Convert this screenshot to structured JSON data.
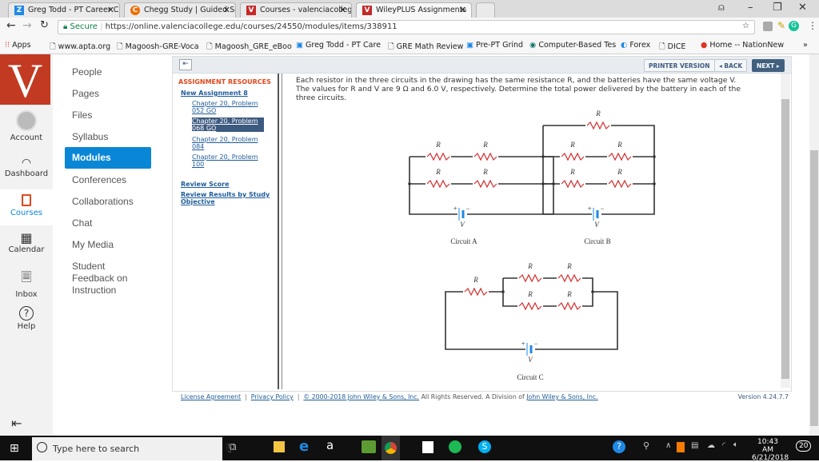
{
  "browser": {
    "tabs": [
      {
        "label": "Greg Todd - PT Career Co",
        "favicon_color": "#1e88e5",
        "icon": "Z"
      },
      {
        "label": "Chegg Study | Guided So",
        "favicon_color": "#ef6c00",
        "icon": "C"
      },
      {
        "label": "Courses - valenciacollege",
        "favicon_color": "#c62828",
        "icon": "V"
      },
      {
        "label": "WileyPLUS Assignments",
        "favicon_color": "#c62828",
        "icon": "V"
      }
    ],
    "secure_label": "Secure",
    "url": "https://online.valenciacollege.edu/courses/24550/modules/items/338911",
    "bookmarks": [
      "Apps",
      "www.apta.org",
      "Magoosh-GRE-Voca",
      "Magoosh_GRE_eBoo",
      "Greg Todd - PT Care",
      "GRE Math Review",
      "Pre-PT Grind",
      "Computer-Based Tes",
      "Forex",
      "DICE",
      "Home -- NationNew"
    ]
  },
  "global_nav": {
    "logo": "V",
    "brand_color": "#c23a22",
    "items": [
      "Account",
      "Dashboard",
      "Courses",
      "Calendar",
      "Inbox",
      "Help"
    ]
  },
  "course_nav": {
    "items": [
      "People",
      "Pages",
      "Files",
      "Syllabus",
      "Modules",
      "Conferences",
      "Collaborations",
      "Chat",
      "My Media",
      "Student Feedback on Instruction"
    ],
    "active": "Modules"
  },
  "toolbar": {
    "printer": "PRINTER VERSION",
    "back": "◂ BACK",
    "next": "NEXT ▸"
  },
  "resources": {
    "heading": "ASSIGNMENT RESOURCES",
    "assignment": "New Assignment 8",
    "problems": [
      "Chapter 20, Problem 052 GO",
      "Chapter 20, Problem 068 GO",
      "Chapter 20, Problem 084",
      "Chapter 20, Problem 100"
    ],
    "selected_problem": "Chapter 20, Problem 068 GO",
    "review_score": "Review Score",
    "review_results": "Review Results by Study Objective"
  },
  "question": {
    "text": "Each resistor in the three circuits in the drawing has the same resistance R, and the batteries have the same voltage V. The values for R and V are 9 Ω and 6.0 V, respectively. Determine the total power delivered by the battery in each of the three circuits.",
    "resistor_label": "R",
    "battery_label": "V",
    "plus": "+",
    "minus": "−",
    "circuits": [
      "Circuit A",
      "Circuit B",
      "Circuit C"
    ]
  },
  "footer": {
    "license": "License Agreement",
    "privacy": "Privacy Policy",
    "copyright": "© 2000-2018 John Wiley & Sons, Inc.",
    "rights": " All Rights Reserved. A Division of ",
    "division": "John Wiley & Sons, Inc.",
    "version": "Version 4.24.7.7"
  },
  "taskbar": {
    "search_placeholder": "Type here to search",
    "time": "10:43 AM",
    "date": "6/21/2018",
    "notifications": "20"
  }
}
